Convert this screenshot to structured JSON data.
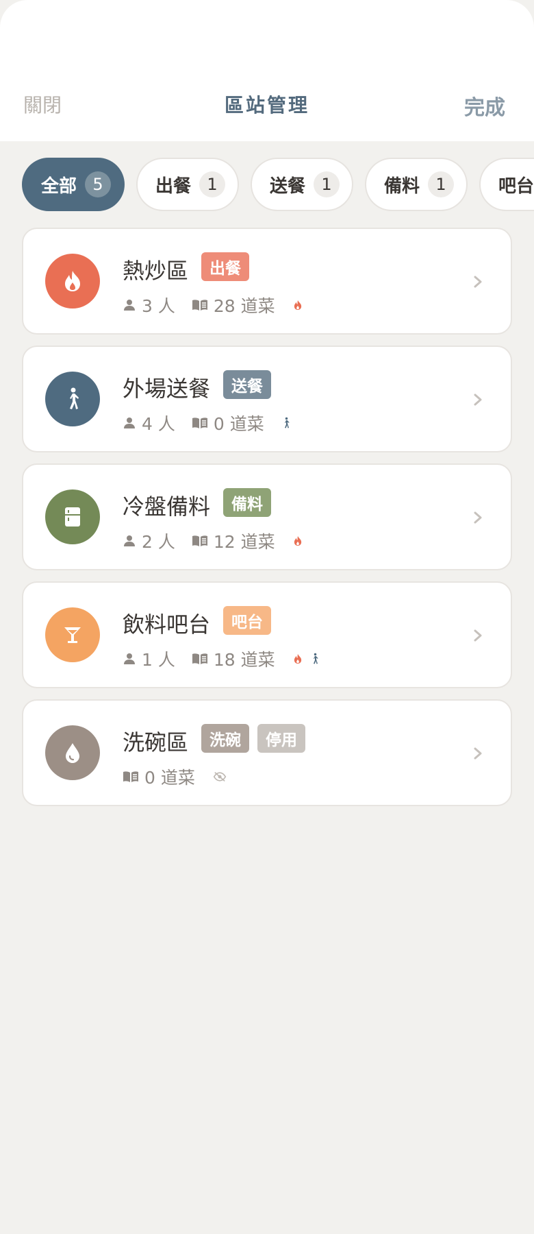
{
  "header": {
    "close_label": "關閉",
    "title": "區站管理",
    "done_label": "完成"
  },
  "filters": [
    {
      "label": "全部",
      "count": "5",
      "active": true
    },
    {
      "label": "出餐",
      "count": "1"
    },
    {
      "label": "送餐",
      "count": "1"
    },
    {
      "label": "備料",
      "count": "1"
    },
    {
      "label": "吧台",
      "count": ""
    }
  ],
  "stations": [
    {
      "name": "熱炒區",
      "icon": "fire-icon",
      "color": "#e96f54",
      "tags": [
        {
          "label": "出餐",
          "color": "#ee8c78"
        }
      ],
      "staff": "3 人",
      "dishes": "28 道菜",
      "indicators": [
        "fire-icon"
      ]
    },
    {
      "name": "外場送餐",
      "icon": "walking-person-icon",
      "color": "#4f6b80",
      "tags": [
        {
          "label": "送餐",
          "color": "#7a8c9a"
        }
      ],
      "staff": "4 人",
      "dishes": "0 道菜",
      "indicators": [
        "walking-person-icon"
      ]
    },
    {
      "name": "冷盤備料",
      "icon": "fridge-icon",
      "color": "#748a57",
      "tags": [
        {
          "label": "備料",
          "color": "#8fa376"
        }
      ],
      "staff": "2 人",
      "dishes": "12 道菜",
      "indicators": [
        "fire-icon"
      ]
    },
    {
      "name": "飲料吧台",
      "icon": "cocktail-glass-icon",
      "color": "#f4a462",
      "tags": [
        {
          "label": "吧台",
          "color": "#f7b887"
        }
      ],
      "staff": "1 人",
      "dishes": "18 道菜",
      "indicators": [
        "fire-icon",
        "walking-person-icon"
      ]
    },
    {
      "name": "洗碗區",
      "icon": "water-drop-icon",
      "color": "#9c8f86",
      "tags": [
        {
          "label": "洗碗",
          "color": "#b0a59d"
        },
        {
          "label": "停用",
          "color": "#c9c4bf"
        }
      ],
      "staff": "",
      "dishes": "0 道菜",
      "indicators": [
        "eye-off-icon"
      ]
    }
  ],
  "colors": {
    "primary": "#4f6b80",
    "background": "#f2f1ee",
    "fire": "#e96f54",
    "muted_text": "#8e8883"
  }
}
